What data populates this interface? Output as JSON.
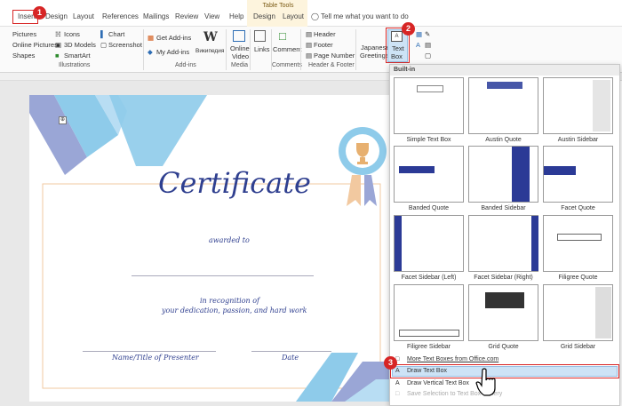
{
  "tabs": {
    "insert": "Insert",
    "design": "Design",
    "layout": "Layout",
    "references": "References",
    "mailings": "Mailings",
    "review": "Review",
    "view": "View",
    "help": "Help",
    "tt_design": "Design",
    "tt_layout": "Layout",
    "tell_me": "Tell me what you want to do"
  },
  "table_tools": "Table Tools",
  "ribbon": {
    "pictures": "Pictures",
    "online_pictures": "Online Pictures",
    "shapes": "Shapes",
    "icons": "Icons",
    "models": "3D Models",
    "smartart": "SmartArt",
    "chart": "Chart",
    "screenshot": "Screenshot",
    "get_addins": "Get Add-ins",
    "my_addins": "My Add-ins",
    "wiki": "Википедия",
    "online_video_1": "Online",
    "online_video_2": "Video",
    "links": "Links",
    "comment": "Comment",
    "header": "Header",
    "footer": "Footer",
    "page_number": "Page Number",
    "japanese_1": "Japanese",
    "japanese_2": "Greetings",
    "textbox_1": "Text",
    "textbox_2": "Box",
    "g_illustrations": "Illustrations",
    "g_addins": "Add-ins",
    "g_media": "Media",
    "g_comments": "Comments",
    "g_headerfooter": "Header & Footer"
  },
  "certificate": {
    "title": "Certificate",
    "awarded": "awarded to",
    "recog1": "in recognition of",
    "recog2": "your dedication, passion, and hard work",
    "presenter": "Name/Title of Presenter",
    "date": "Date"
  },
  "gallery": {
    "header": "Built-in",
    "items": [
      "Simple Text Box",
      "Austin Quote",
      "Austin Sidebar",
      "Banded Quote",
      "Banded Sidebar",
      "Facet Quote",
      "Facet Sidebar (Left)",
      "Facet Sidebar (Right)",
      "Filigree Quote",
      "Filigree Sidebar",
      "Grid Quote",
      "Grid Sidebar"
    ],
    "more": "More Text Boxes from Office.com",
    "draw": "Draw Text Box",
    "draw_vertical": "Draw Vertical Text Box",
    "save_selection": "Save Selection to Text Box Gallery"
  },
  "steps": [
    "1",
    "2",
    "3"
  ],
  "colors": {
    "accent_red": "#d72525",
    "navy": "#2f3f8f",
    "light_blue": "#8ecbea"
  }
}
